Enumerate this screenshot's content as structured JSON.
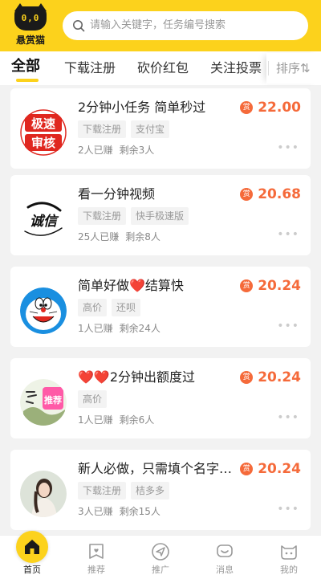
{
  "header": {
    "logo_face_text": "0,0",
    "logo_text": "悬赏猫",
    "search_placeholder": "请输入关键字，任务编号搜索"
  },
  "tabs": [
    {
      "label": "全部",
      "active": true
    },
    {
      "label": "下载注册",
      "active": false
    },
    {
      "label": "砍价红包",
      "active": false
    },
    {
      "label": "关注投票",
      "active": false
    }
  ],
  "sort_label": "排序⇅",
  "tasks": [
    {
      "title": "2分钟小任务 简单秒过",
      "tags": [
        "下载注册",
        "支付宝"
      ],
      "earned": "2人已赚",
      "remaining": "剩余3人",
      "badge": "赏",
      "reward": "22.00",
      "avatar_icon": "jisu-shenhe-icon",
      "avatar_text_1": "极速",
      "avatar_text_2": "审核"
    },
    {
      "title": "看一分钟视频",
      "tags": [
        "下载注册",
        "快手极速版"
      ],
      "earned": "25人已赚",
      "remaining": "剩余8人",
      "badge": "赏",
      "reward": "20.68",
      "avatar_icon": "chengxin-calligraphy-icon",
      "avatar_text_1": "诚信"
    },
    {
      "title": "简单好做❤️结算快",
      "tags": [
        "高价",
        "还呗"
      ],
      "earned": "1人已赚",
      "remaining": "剩余24人",
      "badge": "赏",
      "reward": "20.24",
      "avatar_icon": "doraemon-icon"
    },
    {
      "title": "❤️❤️2分钟出额度过",
      "tags": [
        "高价"
      ],
      "earned": "1人已赚",
      "remaining": "剩余6人",
      "badge": "赏",
      "reward": "20.24",
      "avatar_icon": "tuijian-icon",
      "avatar_text_1": "推荐"
    },
    {
      "title": "新人必做，只需填个名字…",
      "tags": [
        "下载注册",
        "桔多多"
      ],
      "earned": "3人已赚",
      "remaining": "剩余15人",
      "badge": "赏",
      "reward": "20.24",
      "avatar_icon": "person-photo-icon"
    }
  ],
  "more_dots": "•••",
  "nav": [
    {
      "label": "首页",
      "icon": "home-icon",
      "active": true
    },
    {
      "label": "推荐",
      "icon": "recommend-icon",
      "active": false
    },
    {
      "label": "推广",
      "icon": "promote-icon",
      "active": false
    },
    {
      "label": "消息",
      "icon": "message-icon",
      "active": false
    },
    {
      "label": "我的",
      "icon": "cat-profile-icon",
      "active": false
    }
  ],
  "colors": {
    "brand": "#fcd21c",
    "reward": "#f56a3a"
  }
}
